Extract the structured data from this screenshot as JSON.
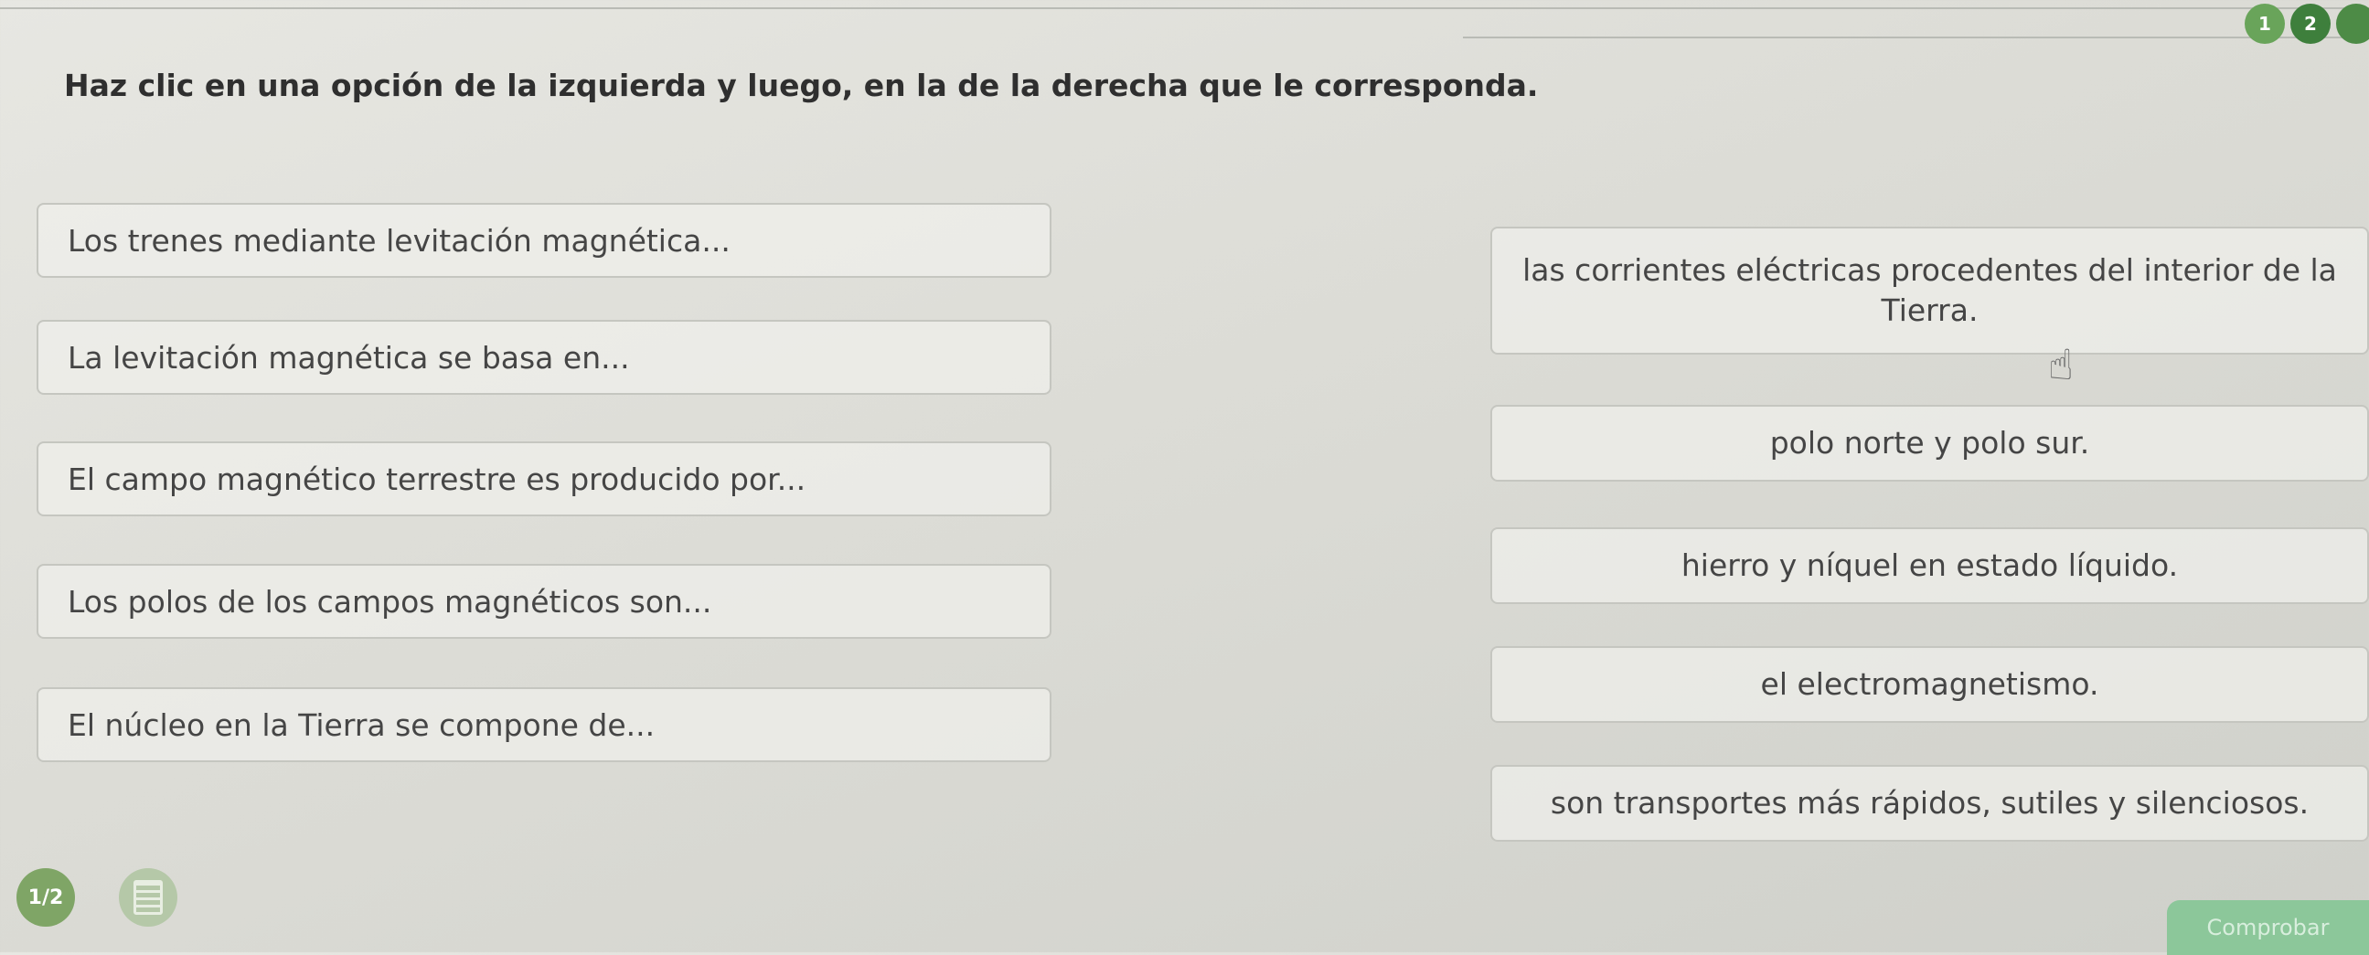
{
  "steps": [
    "1",
    "2",
    ""
  ],
  "instruction": "Haz clic en una opción de la izquierda y luego, en la de la derecha que le corresponda.",
  "left_items": [
    "Los trenes mediante levitación magnética...",
    "La levitación magnética se basa en...",
    "El campo magnético terrestre es producido por...",
    "Los polos de los campos magnéticos son...",
    "El núcleo en la Tierra se compone de..."
  ],
  "right_items": [
    "las corrientes eléctricas procedentes del interior de la Tierra.",
    "polo norte y polo sur.",
    "hierro y níquel en estado líquido.",
    "el electromagnetismo.",
    "son transportes más rápidos, sutiles y silenciosos."
  ],
  "pager": {
    "label": "1/2"
  },
  "check_button": {
    "label": "Comprobar"
  },
  "colors": {
    "accent": "#69a45a",
    "check_button": "#8cc79a"
  },
  "icons": {
    "cursor": "hand-pointer-icon",
    "list": "list-icon"
  }
}
